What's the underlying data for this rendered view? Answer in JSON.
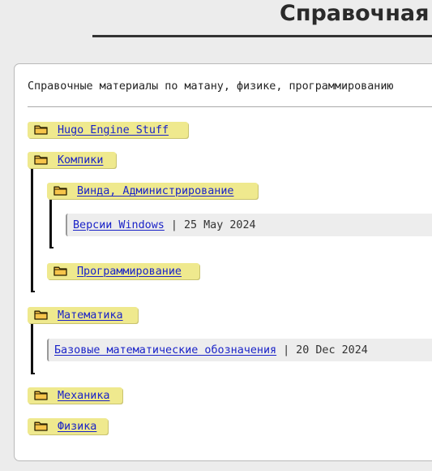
{
  "header": {
    "title": "Справочная"
  },
  "intro": "Справочные материалы по матану, физике, программированию",
  "tree": {
    "hugo": "Hugo Engine Stuff",
    "compiki": "Компики",
    "windows_admin": "Винда, Администрирование",
    "programming": "Программирование",
    "math": "Математика",
    "mechanics": "Механика",
    "physics": "Физика"
  },
  "posts": {
    "windows_versions": {
      "title": "Версии Windows",
      "date": "25 May 2024"
    },
    "math_notation": {
      "title": "Базовые математические обозначения",
      "date": "20 Dec 2024"
    }
  },
  "separator": "|",
  "colors": {
    "folder_bg": "#efe98e",
    "link": "#1a23c8",
    "card_bg": "#ffffff",
    "page_bg": "#ececec"
  },
  "icons": {
    "folder": "folder-icon"
  }
}
